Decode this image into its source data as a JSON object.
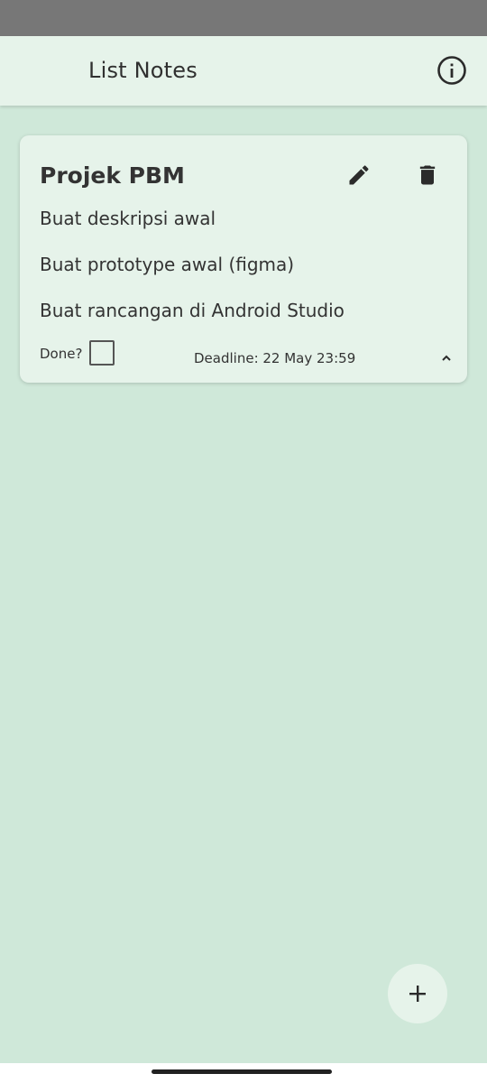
{
  "app_bar": {
    "title": "List Notes",
    "info_icon": "info-icon"
  },
  "note": {
    "title": "Projek PBM",
    "items": [
      "Buat deskripsi awal",
      "Buat prototype awal (figma)",
      "Buat rancangan di Android Studio"
    ],
    "done_label": "Done?",
    "done_checked": false,
    "deadline": "Deadline: 22 May 23:59",
    "edit_icon": "pencil-icon",
    "delete_icon": "trash-icon",
    "collapse_icon": "chevron-up-icon"
  },
  "fab": {
    "icon": "plus-icon"
  },
  "colors": {
    "background": "#cfe8d9",
    "surface": "#e6f3ea",
    "status_bar": "#777777",
    "icon": "#2b2b2b"
  }
}
